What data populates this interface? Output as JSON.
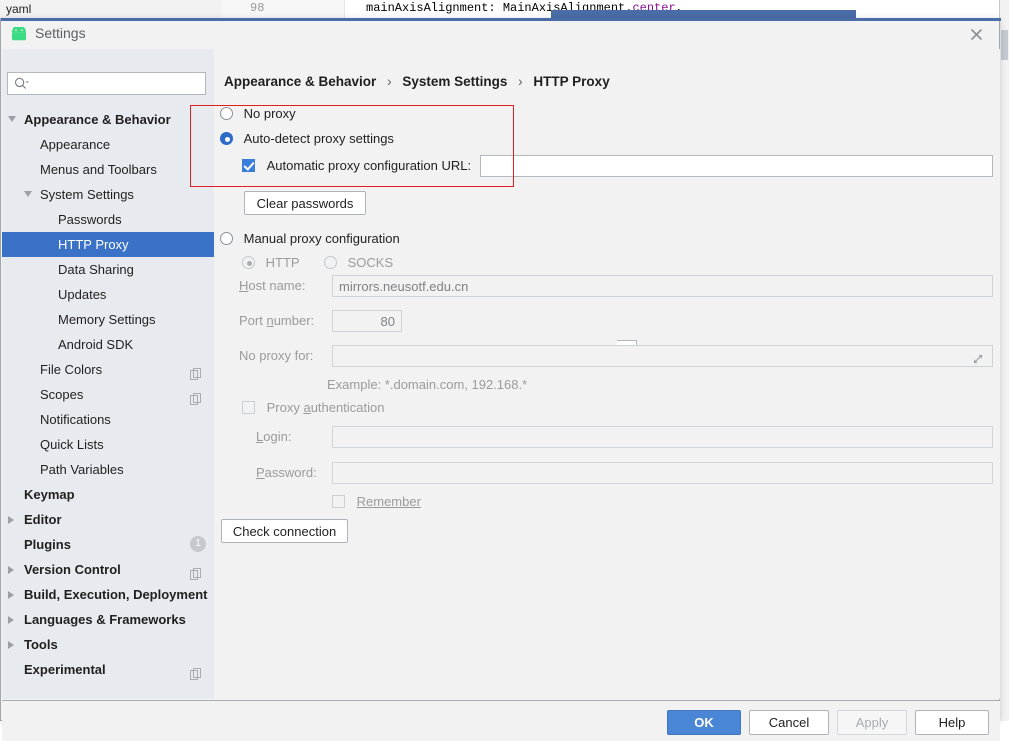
{
  "ide": {
    "tab_label": "yaml",
    "line_number": "98",
    "code_line": "mainAxisAlignment: MainAxisAlignment.",
    "code_value": "center",
    "code_tail": ","
  },
  "dialog": {
    "title": "Settings",
    "icon": "android-icon",
    "close_icon": "close-icon"
  },
  "search": {
    "icon": "search-icon",
    "value": "",
    "placeholder": ""
  },
  "sidebar": {
    "items": [
      {
        "label": "Appearance & Behavior",
        "level": 0,
        "bold": true,
        "arrow": "down",
        "selected": false,
        "trailing": ""
      },
      {
        "label": "Appearance",
        "level": 1,
        "bold": false,
        "arrow": "",
        "selected": false,
        "trailing": ""
      },
      {
        "label": "Menus and Toolbars",
        "level": 1,
        "bold": false,
        "arrow": "",
        "selected": false,
        "trailing": ""
      },
      {
        "label": "System Settings",
        "level": 1,
        "bold": false,
        "arrow": "down",
        "selected": false,
        "trailing": ""
      },
      {
        "label": "Passwords",
        "level": 2,
        "bold": false,
        "arrow": "",
        "selected": false,
        "trailing": ""
      },
      {
        "label": "HTTP Proxy",
        "level": 2,
        "bold": false,
        "arrow": "",
        "selected": true,
        "trailing": ""
      },
      {
        "label": "Data Sharing",
        "level": 2,
        "bold": false,
        "arrow": "",
        "selected": false,
        "trailing": ""
      },
      {
        "label": "Updates",
        "level": 2,
        "bold": false,
        "arrow": "",
        "selected": false,
        "trailing": ""
      },
      {
        "label": "Memory Settings",
        "level": 2,
        "bold": false,
        "arrow": "",
        "selected": false,
        "trailing": ""
      },
      {
        "label": "Android SDK",
        "level": 2,
        "bold": false,
        "arrow": "",
        "selected": false,
        "trailing": ""
      },
      {
        "label": "File Colors",
        "level": 1,
        "bold": false,
        "arrow": "",
        "selected": false,
        "trailing": "copy-icon"
      },
      {
        "label": "Scopes",
        "level": 1,
        "bold": false,
        "arrow": "",
        "selected": false,
        "trailing": "copy-icon"
      },
      {
        "label": "Notifications",
        "level": 1,
        "bold": false,
        "arrow": "",
        "selected": false,
        "trailing": ""
      },
      {
        "label": "Quick Lists",
        "level": 1,
        "bold": false,
        "arrow": "",
        "selected": false,
        "trailing": ""
      },
      {
        "label": "Path Variables",
        "level": 1,
        "bold": false,
        "arrow": "",
        "selected": false,
        "trailing": ""
      },
      {
        "label": "Keymap",
        "level": 0,
        "bold": true,
        "arrow": "",
        "selected": false,
        "trailing": ""
      },
      {
        "label": "Editor",
        "level": 0,
        "bold": true,
        "arrow": "right",
        "selected": false,
        "trailing": ""
      },
      {
        "label": "Plugins",
        "level": 0,
        "bold": true,
        "arrow": "",
        "selected": false,
        "trailing": "badge",
        "badge": "1"
      },
      {
        "label": "Version Control",
        "level": 0,
        "bold": true,
        "arrow": "right",
        "selected": false,
        "trailing": "copy-icon"
      },
      {
        "label": "Build, Execution, Deployment",
        "level": 0,
        "bold": true,
        "arrow": "right",
        "selected": false,
        "trailing": ""
      },
      {
        "label": "Languages & Frameworks",
        "level": 0,
        "bold": true,
        "arrow": "right",
        "selected": false,
        "trailing": ""
      },
      {
        "label": "Tools",
        "level": 0,
        "bold": true,
        "arrow": "right",
        "selected": false,
        "trailing": ""
      },
      {
        "label": "Experimental",
        "level": 0,
        "bold": true,
        "arrow": "",
        "selected": false,
        "trailing": "copy-icon"
      }
    ]
  },
  "breadcrumb": {
    "part1": "Appearance & Behavior",
    "part2": "System Settings",
    "part3": "HTTP Proxy",
    "separator": "›"
  },
  "proxy": {
    "no_proxy_label": "No proxy",
    "no_proxy_selected": false,
    "auto_detect_label": "Auto-detect proxy settings",
    "auto_detect_selected": true,
    "auto_config_label": "Automatic proxy configuration URL:",
    "auto_config_checked": true,
    "auto_config_url": "",
    "clear_passwords_label": "Clear passwords",
    "manual_label": "Manual proxy configuration",
    "manual_selected": false,
    "http_label": "HTTP",
    "http_selected": true,
    "socks_label": "SOCKS",
    "socks_selected": false,
    "host_label": "Host name:",
    "host_value": "mirrors.neusotf.edu.cn",
    "port_label": "Port number:",
    "port_value": "80",
    "no_proxy_for_label": "No proxy for:",
    "no_proxy_for_value": "",
    "example_text": "Example: *.domain.com, 192.168.*",
    "proxy_auth_label": "Proxy authentication",
    "proxy_auth_checked": false,
    "login_label": "Login:",
    "login_value": "",
    "password_label": "Password:",
    "password_value": "",
    "remember_label": "Remember",
    "remember_checked": false,
    "check_connection_label": "Check connection",
    "expand_icon": "expand-icon"
  },
  "footer": {
    "ok": "OK",
    "cancel": "Cancel",
    "apply": "Apply",
    "help": "Help"
  },
  "annotation": {
    "highlight_color": "#e02020"
  }
}
